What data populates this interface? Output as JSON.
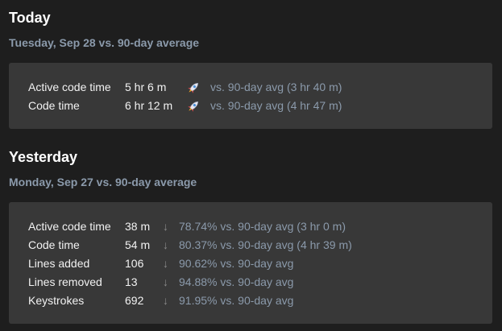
{
  "today": {
    "title": "Today",
    "subtitle": "Tuesday, Sep 28 vs. 90-day average",
    "rows": [
      {
        "label": "Active code time",
        "value": "5 hr 6 m",
        "icon": "rocket-icon",
        "compare": "vs. 90-day avg (3 hr 40 m)"
      },
      {
        "label": "Code time",
        "value": "6 hr 12 m",
        "icon": "rocket-icon",
        "compare": "vs. 90-day avg (4 hr 47 m)"
      }
    ]
  },
  "yesterday": {
    "title": "Yesterday",
    "subtitle": "Monday, Sep 27 vs. 90-day average",
    "rows": [
      {
        "label": "Active code time",
        "value": "38 m",
        "icon": "down-arrow-icon",
        "compare": "78.74% vs. 90-day avg (3 hr 0 m)"
      },
      {
        "label": "Code time",
        "value": "54 m",
        "icon": "down-arrow-icon",
        "compare": "80.37% vs. 90-day avg (4 hr 39 m)"
      },
      {
        "label": "Lines added",
        "value": "106",
        "icon": "down-arrow-icon",
        "compare": "90.62% vs. 90-day avg"
      },
      {
        "label": "Lines removed",
        "value": "13",
        "icon": "down-arrow-icon",
        "compare": "94.88% vs. 90-day avg"
      },
      {
        "label": "Keystrokes",
        "value": "692",
        "icon": "down-arrow-icon",
        "compare": "91.95% vs. 90-day avg"
      }
    ]
  },
  "colors": {
    "background": "#1e1e1e",
    "card": "#383838",
    "subtitle": "#8b9aab",
    "text": "#f2f2f2"
  }
}
